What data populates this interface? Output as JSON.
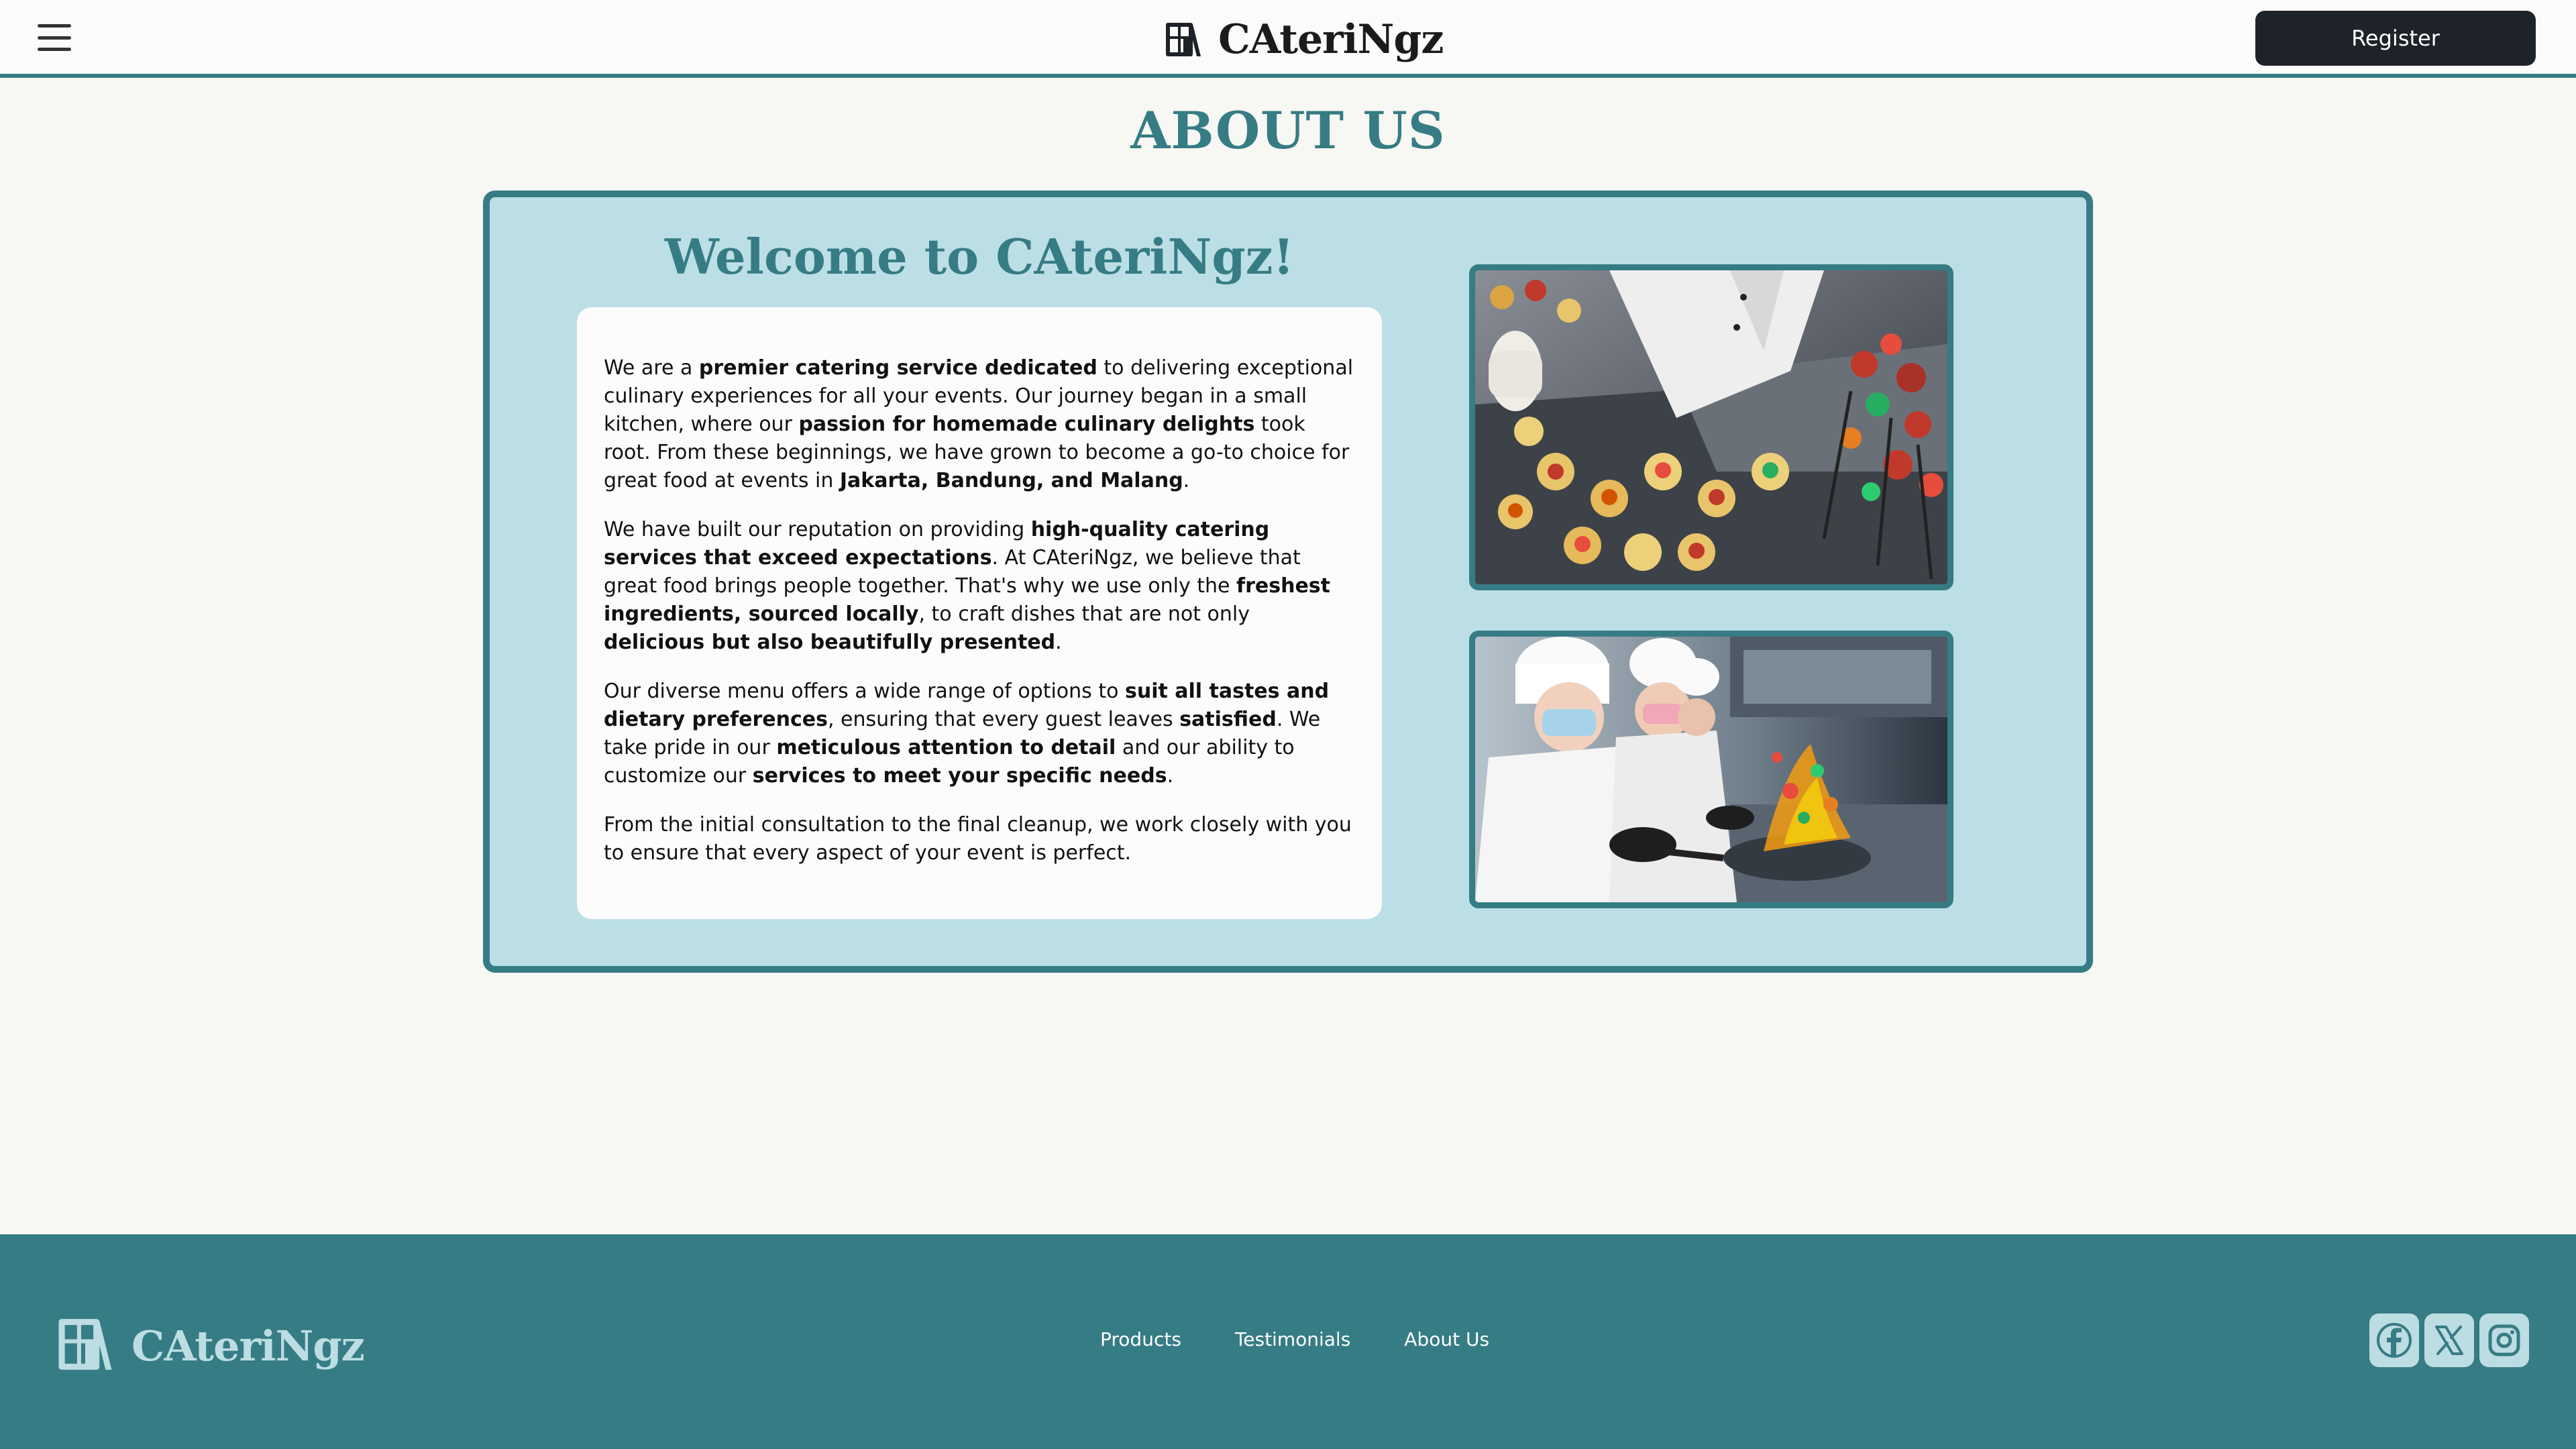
{
  "header": {
    "menu_icon": "hamburger-menu-icon",
    "brand_icon": "book-logo-icon",
    "brand_name": "CAteriNgz",
    "register_label": "Register"
  },
  "page": {
    "title": "ABOUT US"
  },
  "about": {
    "welcome_title": "Welcome to CAteriNgz!",
    "paragraphs": [
      [
        {
          "t": "We are a ",
          "b": false
        },
        {
          "t": "premier catering service dedicated",
          "b": true
        },
        {
          "t": " to delivering exceptional culinary experiences for all your events. Our journey began in a small kitchen, where our ",
          "b": false
        },
        {
          "t": "passion for homemade culinary delights",
          "b": true
        },
        {
          "t": " took root. From these beginnings, we have grown to become a go-to choice for great food at events in ",
          "b": false
        },
        {
          "t": "Jakarta, Bandung, and Malang",
          "b": true
        },
        {
          "t": ".",
          "b": false
        }
      ],
      [
        {
          "t": "We have built our reputation on providing ",
          "b": false
        },
        {
          "t": "high-quality catering services that exceed expectations",
          "b": true
        },
        {
          "t": ". At CAteriNgz, we believe that great food brings people together. That's why we use only the ",
          "b": false
        },
        {
          "t": "freshest ingredients, sourced locally",
          "b": true
        },
        {
          "t": ", to craft dishes that are not only ",
          "b": false
        },
        {
          "t": "delicious but also beautifully presented",
          "b": true
        },
        {
          "t": ".",
          "b": false
        }
      ],
      [
        {
          "t": "Our diverse menu offers a wide range of options to ",
          "b": false
        },
        {
          "t": "suit all tastes and dietary preferences",
          "b": true
        },
        {
          "t": ", ensuring that every guest leaves ",
          "b": false
        },
        {
          "t": "satisfied",
          "b": true
        },
        {
          "t": ". We take pride in our ",
          "b": false
        },
        {
          "t": "meticulous attention to detail",
          "b": true
        },
        {
          "t": " and our ability to customize our ",
          "b": false
        },
        {
          "t": "services to meet your specific needs",
          "b": true
        },
        {
          "t": ".",
          "b": false
        }
      ],
      [
        {
          "t": "From the initial consultation to the final cleanup, we work closely with you to ensure that every aspect of your event is perfect.",
          "b": false
        }
      ]
    ],
    "images": [
      {
        "name": "catering-food-photo"
      },
      {
        "name": "chefs-cooking-photo"
      }
    ]
  },
  "footer": {
    "brand_icon": "book-logo-icon",
    "brand_name": "CAteriNgz",
    "links": [
      "Products",
      "Testimonials",
      "About Us"
    ],
    "socials": [
      "facebook-icon",
      "x-icon",
      "instagram-icon"
    ]
  },
  "colors": {
    "primary": "#367c84",
    "card_bg": "#bbdfe5",
    "page_bg": "#f7f7f3",
    "button_dark": "#1d2329",
    "footer_accent": "#bcdde2"
  }
}
